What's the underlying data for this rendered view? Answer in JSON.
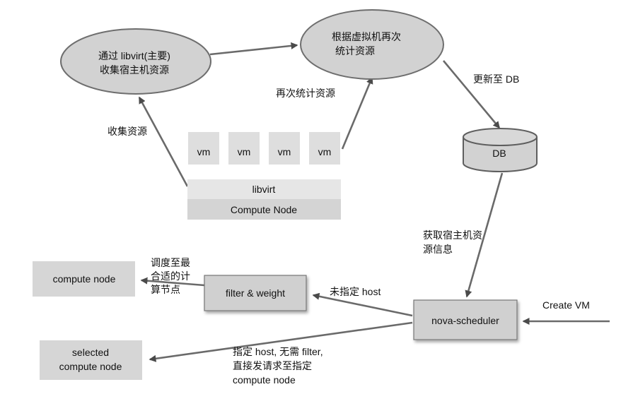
{
  "nodes": {
    "libvirt_collect": [
      "通过 libvirt(主要)",
      "收集宿主机资源"
    ],
    "recount": [
      "根据虚拟机再次",
      "统计资源"
    ],
    "db": "DB",
    "vm_labels": [
      "vm",
      "vm",
      "vm",
      "vm"
    ],
    "libvirt": "libvirt",
    "compute_node_main": "Compute Node",
    "compute_node_target": "compute node",
    "filter_weight": "filter & weight",
    "nova_scheduler": "nova-scheduler",
    "selected_node": [
      "selected",
      "compute node"
    ]
  },
  "edge_labels": {
    "collect": "收集资源",
    "recount": "再次统计资源",
    "update_db": "更新至 DB",
    "fetch": [
      "获取宿主机资",
      "源信息"
    ],
    "schedule": [
      "调度至最",
      "合适的计",
      "算节点"
    ],
    "no_host": "未指定 host",
    "create_vm": "Create VM",
    "specified_host": [
      "指定 host, 无需 filter,",
      "直接发请求至指定",
      "compute node"
    ]
  }
}
